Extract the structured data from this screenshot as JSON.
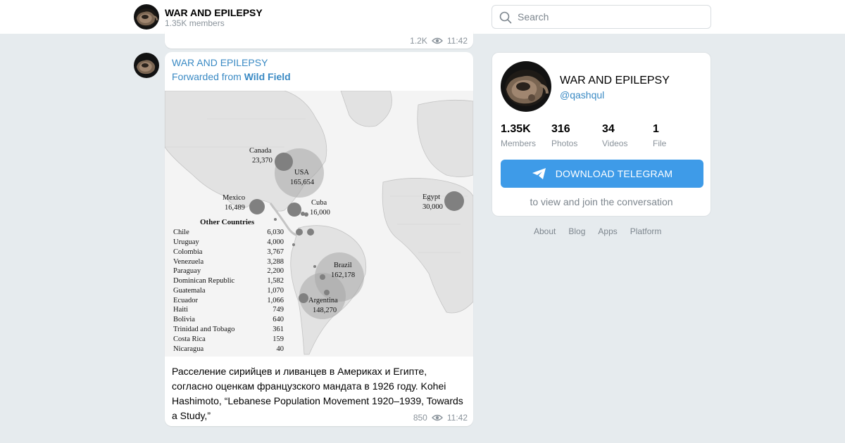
{
  "header": {
    "title": "WAR AND EPILEPSY",
    "members": "1.35K members",
    "search_placeholder": "Search"
  },
  "prev_message": {
    "views": "1.2K",
    "time": "11:42"
  },
  "message": {
    "channel": "WAR AND EPILEPSY",
    "forwarded_prefix": "Forwarded from ",
    "forwarded_source": "Wild Field",
    "caption": "Расселение сирийцев и ливанцев в Америках и Египте, согласно оценкам французского мандата в 1926 году. Kohei Hashimoto, “Lebanese Population Movement 1920–1939, Towards a Study,”",
    "views": "850",
    "time": "11:42",
    "map": {
      "labels": [
        {
          "name": "Canada",
          "value": "23,370"
        },
        {
          "name": "USA",
          "value": "165,654"
        },
        {
          "name": "Mexico",
          "value": "16,489"
        },
        {
          "name": "Cuba",
          "value": "16,000"
        },
        {
          "name": "Egypt",
          "value": "30,000"
        },
        {
          "name": "Brazil",
          "value": "162,178"
        },
        {
          "name": "Argentina",
          "value": "148,270"
        }
      ],
      "other_title": "Other Countries",
      "other": [
        {
          "name": "Chile",
          "value": "6,030"
        },
        {
          "name": "Uruguay",
          "value": "4,000"
        },
        {
          "name": "Colombia",
          "value": "3,767"
        },
        {
          "name": "Venezuela",
          "value": "3,288"
        },
        {
          "name": "Paraguay",
          "value": "2,200"
        },
        {
          "name": "Dominican Republic",
          "value": "1,582"
        },
        {
          "name": "Guatemala",
          "value": "1,070"
        },
        {
          "name": "Ecuador",
          "value": "1,066"
        },
        {
          "name": "Haiti",
          "value": "749"
        },
        {
          "name": "Bolivia",
          "value": "640"
        },
        {
          "name": "Trinidad and Tobago",
          "value": "361"
        },
        {
          "name": "Costa Rica",
          "value": "159"
        },
        {
          "name": "Nicaragua",
          "value": "40"
        }
      ]
    }
  },
  "card": {
    "title": "WAR AND EPILEPSY",
    "handle": "@qashqul",
    "stats": [
      {
        "num": "1.35K",
        "label": "Members"
      },
      {
        "num": "316",
        "label": "Photos"
      },
      {
        "num": "34",
        "label": "Videos"
      },
      {
        "num": "1",
        "label": "File"
      }
    ],
    "download_label": "DOWNLOAD TELEGRAM",
    "note": "to view and join the conversation"
  },
  "footer": {
    "links": [
      "About",
      "Blog",
      "Apps",
      "Platform"
    ]
  },
  "colors": {
    "accent": "#3a8ac4",
    "button": "#3e9be8",
    "background": "#e6ebee"
  }
}
